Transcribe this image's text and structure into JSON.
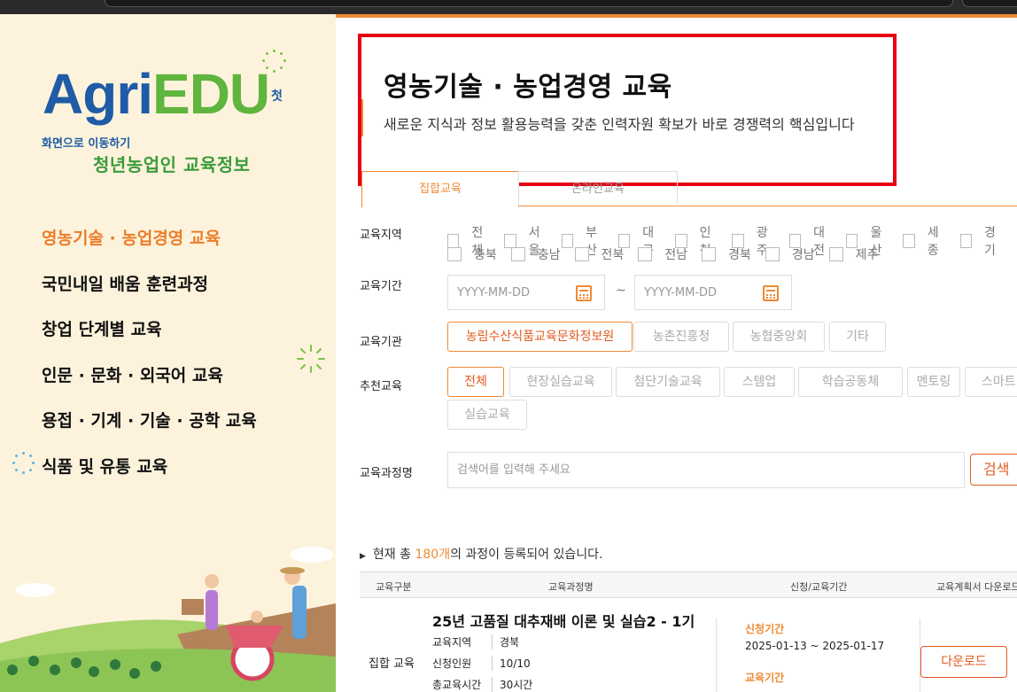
{
  "sidebar": {
    "logo_agri": "Agri",
    "logo_edu": "EDU",
    "logo_side": "첫",
    "subtitle1": "화면으로 이동하기",
    "subtitle2": "청년농업인 교육정보",
    "menu": [
      {
        "label": "영농기술 · 농업경영 교육",
        "active": true
      },
      {
        "label": "국민내일 배움 훈련과정"
      },
      {
        "label": "창업 단계별 교육"
      },
      {
        "label": "인문 · 문화 · 외국어 교육"
      },
      {
        "label": "용접 · 기계 · 기술 · 공학 교육"
      },
      {
        "label": "식품 및 유통 교육"
      }
    ]
  },
  "hero": {
    "title": "영농기술 · 농업경영 교육",
    "subtitle": "새로운 지식과 정보 활용능력을 갖춘 인력자원 확보가 바로 경쟁력의 핵심입니다"
  },
  "tabs": [
    "집합교육",
    "온라인교육"
  ],
  "filters": {
    "region_label": "교육지역",
    "regions_row1": [
      "전체",
      "서울",
      "부산",
      "대구",
      "인천",
      "광주",
      "대전",
      "울산",
      "세종",
      "경기"
    ],
    "regions_row2": [
      "충북",
      "충남",
      "전북",
      "전남",
      "경북",
      "경남",
      "제주"
    ],
    "period_label": "교육기간",
    "date_placeholder": "YYYY-MM-DD",
    "tilde": "~",
    "org_label": "교육기관",
    "orgs": [
      "농림수산식품교육문화정보원",
      "농촌진흥청",
      "농협중앙회",
      "기타"
    ],
    "rec_label": "추천교육",
    "recs_row1": [
      "전체",
      "현장실습교육",
      "첨단기술교육",
      "스템업",
      "학습공동체",
      "멘토링",
      "스마트"
    ],
    "recs_row2": [
      "실습교육"
    ],
    "name_label": "교육과정명",
    "search_placeholder": "검색어를 입력해 주세요",
    "search_button": "검색"
  },
  "results": {
    "prefix": "현재 총 ",
    "count": "180개",
    "suffix": "의 과정이 등록되어 있습니다.",
    "headers": [
      "교육구분",
      "교육과정명",
      "신청/교육기간",
      "교육계획서 다운로드"
    ],
    "row": {
      "kind": "집합 교육",
      "title": "25년 고품질 대추재배 이론 및 실습2 - 1기",
      "details": [
        {
          "k": "교육지역",
          "v": "경북"
        },
        {
          "k": "신청인원",
          "v": "10/10"
        },
        {
          "k": "총교육시간",
          "v": "30시간"
        }
      ],
      "apply_label": "신청기간",
      "apply_period": "2025-01-13 ~ 2025-01-17",
      "edu_label": "교육기간",
      "download": "다운로드"
    }
  },
  "colors": {
    "accent": "#ef8a33",
    "brand_blue": "#1f5ba6",
    "brand_green": "#5fb53d",
    "highlight": "#e60012"
  }
}
